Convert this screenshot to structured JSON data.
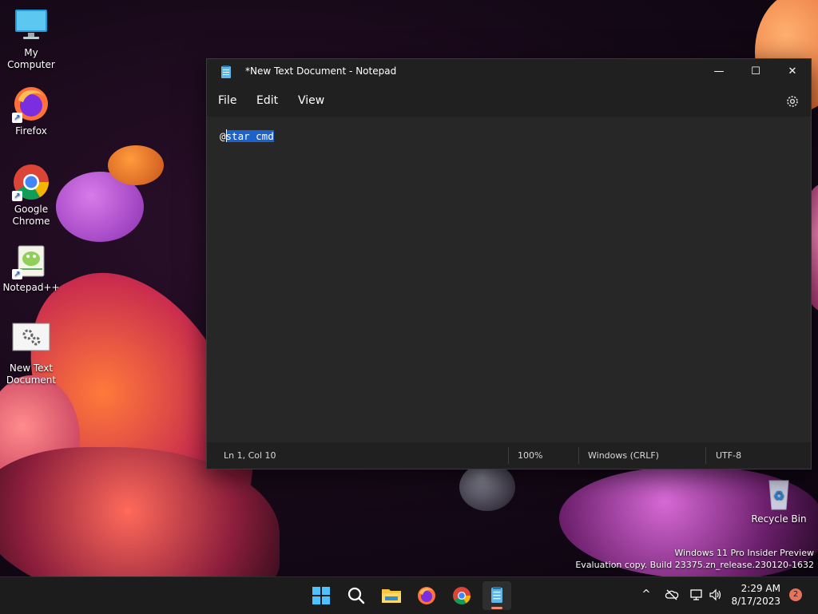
{
  "desktop": {
    "icons": [
      {
        "label": "My Computer"
      },
      {
        "label": "Firefox"
      },
      {
        "label": "Google Chrome"
      },
      {
        "label": "Notepad++"
      },
      {
        "label": "New Text Document"
      },
      {
        "label": "Recycle Bin"
      }
    ],
    "watermark": {
      "line1": "Windows 11 Pro Insider Preview",
      "line2": "Evaluation copy. Build 23375.zn_release.230120-1632"
    }
  },
  "window": {
    "title": "*New Text Document - Notepad",
    "controls": {
      "minimize": "—",
      "maximize": "☐",
      "close": "✕"
    },
    "menu": {
      "file": "File",
      "edit": "Edit",
      "view": "View"
    },
    "editor": {
      "text_prefix": "@",
      "text_selected": "star cmd"
    },
    "status": {
      "position": "Ln 1, Col 10",
      "zoom": "100%",
      "line_ending": "Windows (CRLF)",
      "encoding": "UTF-8"
    }
  },
  "taskbar": {
    "tray_chevron": "^",
    "clock_time": "2:29 AM",
    "clock_date": "8/17/2023",
    "notification_count": "2"
  },
  "colors": {
    "selection": "#1c62c9",
    "accent_underline": "#f08a74",
    "notification_badge": "#e8735d"
  }
}
